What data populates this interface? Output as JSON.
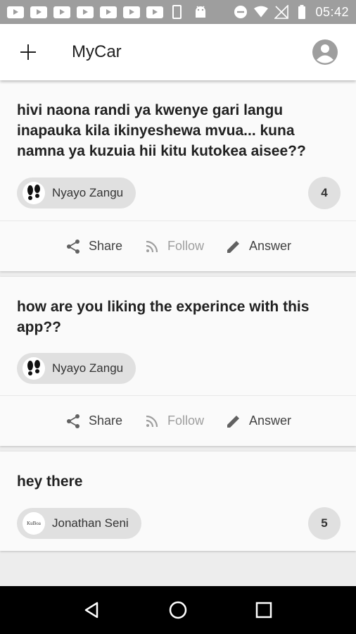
{
  "status_bar": {
    "time": "05:42",
    "notification_icons": [
      "youtube-icon",
      "youtube-icon",
      "youtube-icon",
      "youtube-icon",
      "youtube-icon",
      "youtube-icon",
      "youtube-icon"
    ],
    "right_icons": [
      "do-not-disturb-icon",
      "wifi-icon",
      "no-signal-icon",
      "battery-icon"
    ]
  },
  "app_bar": {
    "title": "MyCar",
    "left_icon": "add-icon",
    "right_icon": "account-circle-icon"
  },
  "actions": {
    "share": "Share",
    "follow": "Follow",
    "answer": "Answer"
  },
  "posts": [
    {
      "question": "hivi naona randi ya kwenye gari langu inapauka kila ikinyeshewa mvua... kuna namna ya kuzuia hii kitu kutokea aisee??",
      "author": "Nyayo Zangu",
      "answer_count": "4"
    },
    {
      "question": "how are you liking the experince with this app??",
      "author": "Nyayo Zangu",
      "answer_count": ""
    },
    {
      "question": "hey there",
      "author": "Jonathan Seni",
      "answer_count": "5"
    }
  ],
  "nav_bar": {
    "icons": [
      "back-icon",
      "home-icon",
      "recents-icon"
    ]
  }
}
